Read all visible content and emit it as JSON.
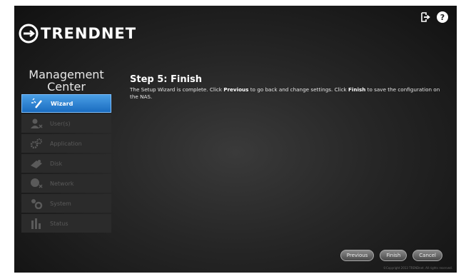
{
  "header": {
    "logo_text": "TRENDNET",
    "icons": [
      "logout-icon",
      "help-icon"
    ],
    "help_glyph": "?"
  },
  "sidebar": {
    "title_line1": "Management",
    "title_line2": "Center",
    "items": [
      {
        "label": "Wizard",
        "icon": "wizard-wand-icon",
        "active": true
      },
      {
        "label": "User(s)",
        "icon": "users-icon",
        "active": false
      },
      {
        "label": "Application",
        "icon": "application-gears-icon",
        "active": false
      },
      {
        "label": "Disk",
        "icon": "disk-icon",
        "active": false
      },
      {
        "label": "Network",
        "icon": "network-icon",
        "active": false
      },
      {
        "label": "System",
        "icon": "system-gears-icon",
        "active": false
      },
      {
        "label": "Status",
        "icon": "status-bars-icon",
        "active": false
      }
    ]
  },
  "main": {
    "step_title": "Step 5: Finish",
    "desc_part1": "The Setup Wizard is complete. Click ",
    "desc_bold1": "Previous",
    "desc_part2": " to go back and change settings. Click ",
    "desc_bold2": "Finish",
    "desc_part3": " to save the configuration on the NAS."
  },
  "footer": {
    "previous_label": "Previous",
    "finish_label": "Finish",
    "cancel_label": "Cancel",
    "copyright": "©Copyright 2013 TRENDnet. All rights reserved."
  },
  "colors": {
    "accent": "#2a84d8",
    "background": "#262626"
  }
}
